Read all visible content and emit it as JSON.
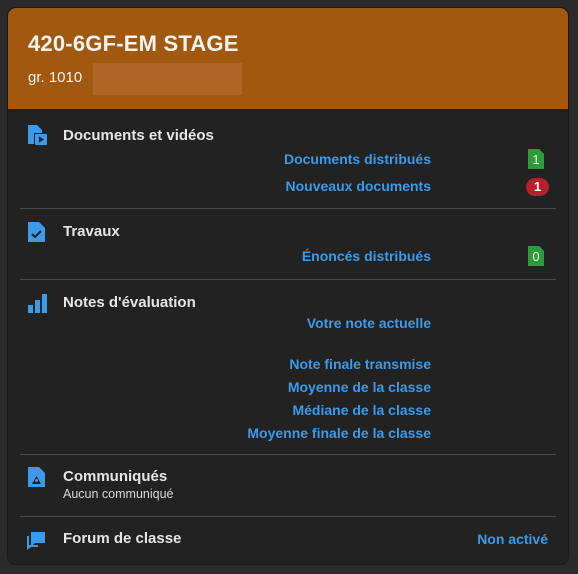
{
  "header": {
    "course_title": "420-6GF-EM STAGE",
    "group_label": "gr. 1010"
  },
  "sections": {
    "documents": {
      "title": "Documents et vidéos",
      "links": {
        "distributed": "Documents distribués",
        "new": "Nouveaux documents"
      },
      "distributed_count": "1",
      "new_count": "1"
    },
    "travaux": {
      "title": "Travaux",
      "links": {
        "statements": "Énoncés distribués"
      },
      "statements_count": "0"
    },
    "notes": {
      "title": "Notes d'évaluation",
      "links": {
        "current_grade": "Votre note actuelle",
        "final_grade": "Note finale transmise",
        "class_average": "Moyenne de la classe",
        "class_median": "Médiane de la classe",
        "final_class_average": "Moyenne finale de la classe"
      }
    },
    "communiques": {
      "title": "Communiqués",
      "subtitle": "Aucun communiqué"
    },
    "forum": {
      "title": "Forum de classe",
      "status": "Non activé"
    }
  },
  "colors": {
    "header_bg": "#a1580f",
    "card_bg": "#222222",
    "link": "#3d9ae8",
    "count_green": "#2e9a3a",
    "count_red": "#b5202a"
  }
}
